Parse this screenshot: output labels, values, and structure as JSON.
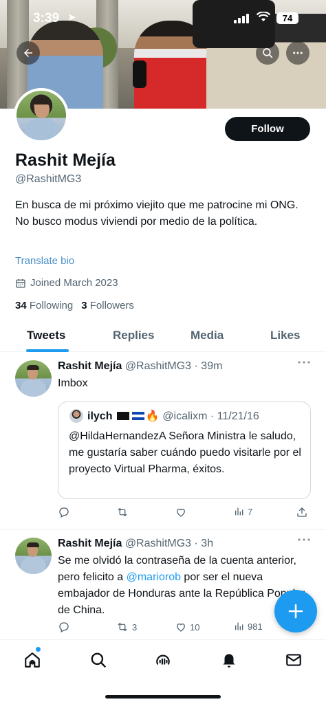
{
  "status_bar": {
    "time": "3:39",
    "battery": "74"
  },
  "profile": {
    "name": "Rashit Mejía",
    "handle": "@RashitMG3",
    "bio": "En busca de mi próximo viejito que me patrocine mi ONG. No busco modus viviendi por medio de la política.",
    "translate_label": "Translate bio",
    "joined": "Joined March 2023",
    "following_count": "34",
    "following_label": "Following",
    "followers_count": "3",
    "followers_label": "Followers",
    "follow_button": "Follow"
  },
  "tabs": [
    {
      "label": "Tweets",
      "active": true
    },
    {
      "label": "Replies"
    },
    {
      "label": "Media"
    },
    {
      "label": "Likes"
    }
  ],
  "tweets": [
    {
      "name": "Rashit Mejía",
      "meta": "@RashitMG3 · 39m",
      "text": "Imbox",
      "quote": {
        "name": "ilych",
        "meta": "@icalixm · 11/21/16",
        "text": "@HildaHernandezA Señora Ministra le saludo, me gustaría saber cuándo puedo visitarle por el proyecto Virtual Pharma, éxitos."
      },
      "views": "7"
    },
    {
      "name": "Rashit Mejía",
      "meta": "@RashitMG3 · 3h",
      "text_before": "Se me olvidó la contraseña de la cuenta anterior, pero felicito a ",
      "mention": "@mariorob",
      "text_after": " por ser el nueva embajador de Honduras ante la República Popular de China.",
      "retweets": "3",
      "likes": "10",
      "views": "981"
    }
  ],
  "colors": {
    "accent": "#1d9bf0",
    "text": "#0f1419",
    "secondary": "#536471"
  }
}
